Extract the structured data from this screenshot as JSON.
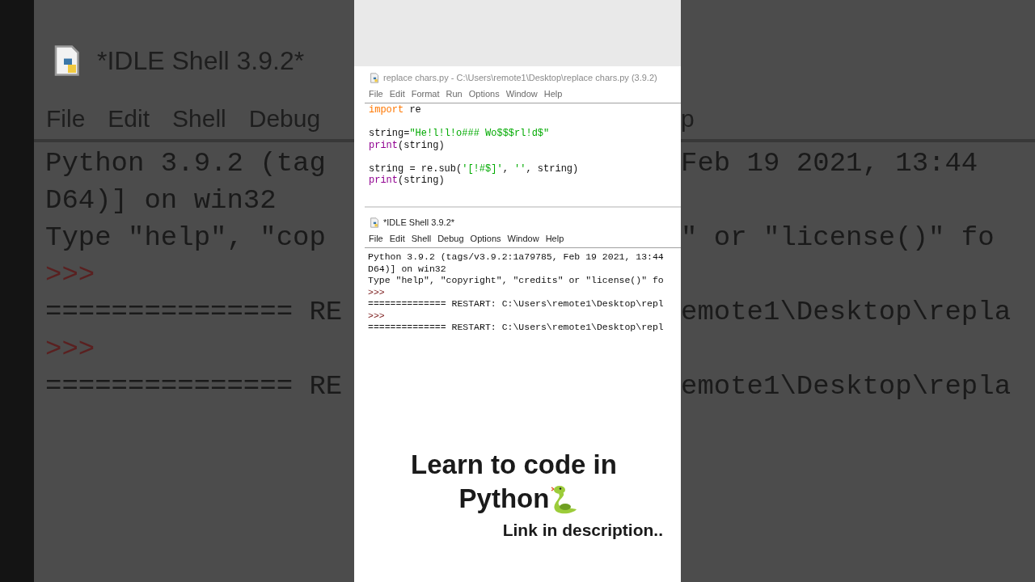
{
  "background_shell": {
    "title": "*IDLE Shell 3.9.2*",
    "menu_left": [
      "File",
      "Edit",
      "Shell",
      "Debug"
    ],
    "menu_right": [
      "p"
    ],
    "lines": [
      {
        "kind": "output",
        "left": "Python 3.9.2 (tag",
        "right": "Feb 19 2021, 13:44"
      },
      {
        "kind": "output",
        "left": "D64)] on win32"
      },
      {
        "kind": "output",
        "left": "Type \"help\", \"cop",
        "right": "\" or \"license()\" fo"
      },
      {
        "kind": "prompt",
        "left": ">>>"
      },
      {
        "kind": "output",
        "left": "=============== RE",
        "right": "emote1\\Desktop\\repla"
      },
      {
        "kind": "prompt",
        "left": ">>>"
      },
      {
        "kind": "output",
        "left": "=============== RE",
        "right": "emote1\\Desktop\\repla"
      }
    ]
  },
  "editor": {
    "title": "replace chars.py - C:\\Users\\remote1\\Desktop\\replace chars.py (3.9.2)",
    "menu": [
      "File",
      "Edit",
      "Format",
      "Run",
      "Options",
      "Window",
      "Help"
    ],
    "lines": [
      {
        "kind": "code",
        "tokens": [
          {
            "text": "import",
            "kind": "keyword"
          },
          {
            "text": " re",
            "kind": "plain"
          }
        ]
      },
      {
        "kind": "blank"
      },
      {
        "kind": "code",
        "tokens": [
          {
            "text": "string=",
            "kind": "plain"
          },
          {
            "text": "\"He!l!l!o### Wo$$$rl!d$\"",
            "kind": "string"
          }
        ]
      },
      {
        "kind": "code",
        "tokens": [
          {
            "text": "print",
            "kind": "builtin"
          },
          {
            "text": "(string)",
            "kind": "plain"
          }
        ]
      },
      {
        "kind": "blank"
      },
      {
        "kind": "code",
        "tokens": [
          {
            "text": "string = re.sub(",
            "kind": "plain"
          },
          {
            "text": "'[!#$]'",
            "kind": "string"
          },
          {
            "text": ", ",
            "kind": "plain"
          },
          {
            "text": "''",
            "kind": "string"
          },
          {
            "text": ", string)",
            "kind": "plain"
          }
        ]
      },
      {
        "kind": "code",
        "tokens": [
          {
            "text": "print",
            "kind": "builtin"
          },
          {
            "text": "(string)",
            "kind": "plain"
          }
        ]
      }
    ]
  },
  "shell": {
    "title": "*IDLE Shell 3.9.2*",
    "menu": [
      "File",
      "Edit",
      "Shell",
      "Debug",
      "Options",
      "Window",
      "Help"
    ],
    "lines": [
      {
        "kind": "output",
        "text": "Python 3.9.2 (tags/v3.9.2:1a79785, Feb 19 2021, 13:44"
      },
      {
        "kind": "output",
        "text": "D64)] on win32"
      },
      {
        "kind": "output",
        "text": "Type \"help\", \"copyright\", \"credits\" or \"license()\" fo"
      },
      {
        "kind": "prompt",
        "text": ">>>"
      },
      {
        "kind": "output",
        "text": "============== RESTART: C:\\Users\\remote1\\Desktop\\repl"
      },
      {
        "kind": "prompt",
        "text": ">>>"
      },
      {
        "kind": "output",
        "text": "============== RESTART: C:\\Users\\remote1\\Desktop\\repl"
      }
    ]
  },
  "caption": {
    "headline_1": "Learn to code in",
    "headline_2": "Python",
    "subline": "Link in description.."
  }
}
